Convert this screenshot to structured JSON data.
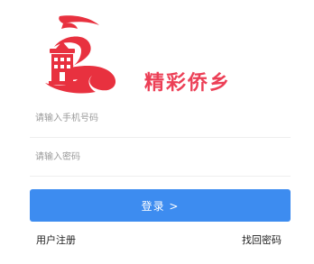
{
  "brand": {
    "title": "精彩侨乡",
    "accent": "#ec3f56"
  },
  "login_form": {
    "phone_placeholder": "请输入手机号码",
    "password_placeholder": "请输入密码",
    "submit_label": "登录 >",
    "button_color": "#3d8cf0"
  },
  "footer": {
    "register_label": "用户注册",
    "forgot_password_label": "找回密码"
  }
}
